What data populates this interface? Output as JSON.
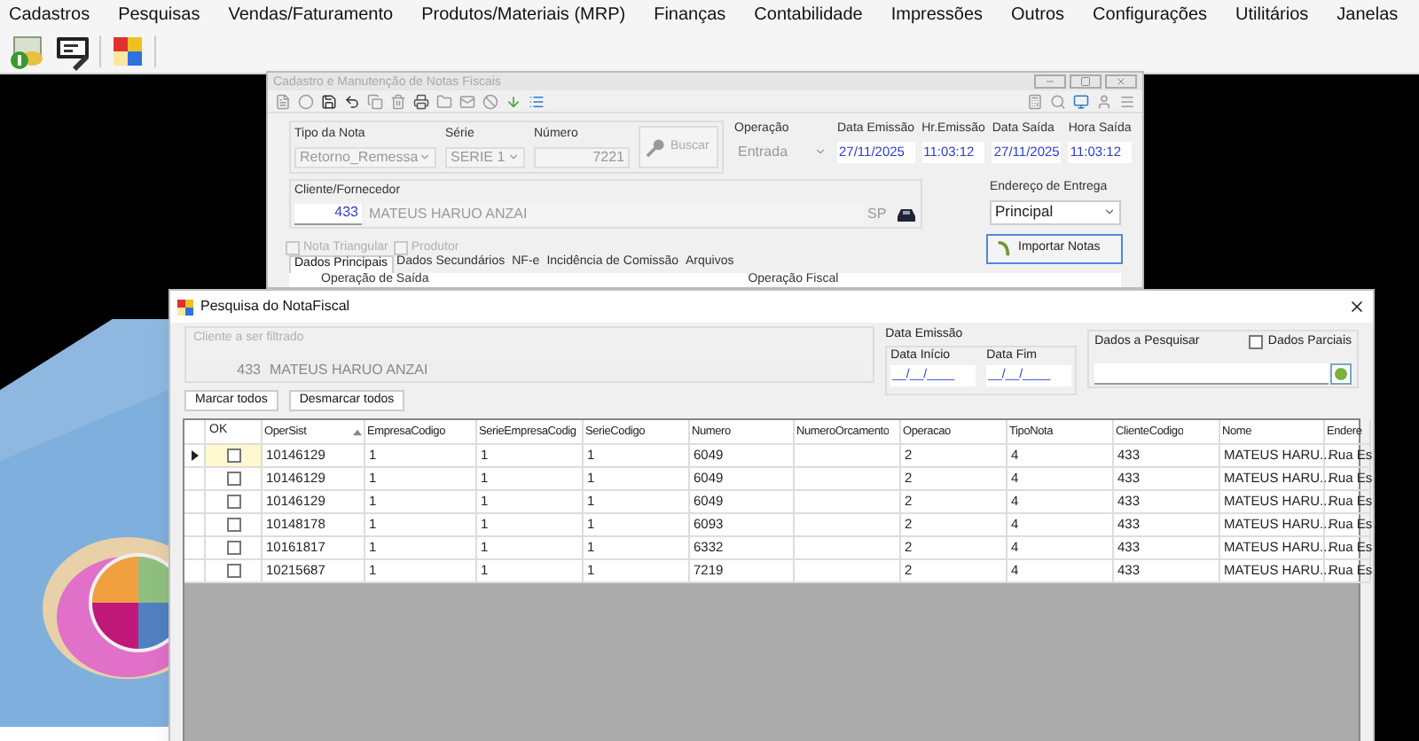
{
  "menu": [
    "Cadastros",
    "Pesquisas",
    "Vendas/Faturamento",
    "Produtos/Materiais (MRP)",
    "Finanças",
    "Contabilidade",
    "Impressões",
    "Outros",
    "Configurações",
    "Utilitários",
    "Janelas"
  ],
  "back_window": {
    "title": "Cadastro e Manutenção de Notas Fiscais",
    "tipo_nota": {
      "label": "Tipo da Nota",
      "value": "Retorno_Remessa"
    },
    "serie": {
      "label": "Série",
      "value": "SERIE 1"
    },
    "numero": {
      "label": "Número",
      "value": "7221"
    },
    "buscar_button": "Buscar",
    "operacao": {
      "label": "Operação",
      "value": "Entrada"
    },
    "dates": [
      {
        "label": "Data Emissão",
        "value": "27/11/2025"
      },
      {
        "label": "Hr.Emissão",
        "value": "11:03:12"
      },
      {
        "label": "Data Saída",
        "value": "27/11/2025"
      },
      {
        "label": "Hora Saída",
        "value": "11:03:12"
      }
    ],
    "cliente": {
      "label": "Cliente/Fornecedor",
      "code": "433",
      "name": "MATEUS HARUO ANZAI",
      "uf": "SP"
    },
    "endereco": {
      "label": "Endereço de Entrega",
      "value": "Principal"
    },
    "checkboxes": [
      {
        "label": "Nota Triangular",
        "checked": false,
        "disabled": true
      },
      {
        "label": "Produtor",
        "checked": false,
        "disabled": true
      }
    ],
    "importar_button": "Importar Notas",
    "tabs": [
      {
        "label": "Dados Principais",
        "selected": true
      },
      {
        "label": "Dados Secundários",
        "selected": false
      },
      {
        "label": "NF-e",
        "selected": false
      },
      {
        "label": "Incidência de Comissão",
        "selected": false
      },
      {
        "label": "Arquivos",
        "selected": false
      }
    ],
    "groups": [
      "Operação de Saída",
      "Operação Fiscal"
    ]
  },
  "dialog": {
    "title": "Pesquisa do NotaFiscal",
    "cliente_filter": {
      "label": "Cliente a ser filtrado",
      "code": "433",
      "name": "MATEUS HARUO ANZAI"
    },
    "data_emissao": {
      "label": "Data Emissão",
      "start": {
        "label": "Data Início",
        "value": "__/__/____"
      },
      "end": {
        "label": "Data Fim",
        "value": "__/__/____"
      }
    },
    "dados_pesquisar": {
      "label": "Dados a Pesquisar",
      "partial": {
        "label": "Dados Parciais",
        "checked": false
      }
    },
    "buttons": [
      "Marcar todos",
      "Desmarcar todos"
    ],
    "table": {
      "check_column": "OK",
      "columns": [
        {
          "label": "OperSist",
          "sorted": true
        },
        {
          "label": "EmpresaCodigo",
          "sorted": false
        },
        {
          "label": "SerieEmpresaCodig",
          "sorted": false
        },
        {
          "label": "SerieCodigo",
          "sorted": false
        },
        {
          "label": "Numero",
          "sorted": false
        },
        {
          "label": "NumeroOrcamento",
          "sorted": false
        },
        {
          "label": "Operacao",
          "sorted": false
        },
        {
          "label": "TipoNota",
          "sorted": false
        },
        {
          "label": "ClienteCodigo",
          "sorted": false
        },
        {
          "label": "Nome",
          "sorted": false
        },
        {
          "label": "Endere",
          "sorted": false
        }
      ],
      "rows": [
        {
          "selected": true,
          "checked": false,
          "cells": [
            "10146129",
            "1",
            "1",
            "1",
            "6049",
            "",
            "2",
            "4",
            "433",
            "MATEUS HARU...",
            "Rua Es"
          ]
        },
        {
          "selected": false,
          "checked": false,
          "cells": [
            "10146129",
            "1",
            "1",
            "1",
            "6049",
            "",
            "2",
            "4",
            "433",
            "MATEUS HARU...",
            "Rua Es"
          ]
        },
        {
          "selected": false,
          "checked": false,
          "cells": [
            "10146129",
            "1",
            "1",
            "1",
            "6049",
            "",
            "2",
            "4",
            "433",
            "MATEUS HARU...",
            "Rua Es"
          ]
        },
        {
          "selected": false,
          "checked": false,
          "cells": [
            "10148178",
            "1",
            "1",
            "1",
            "6093",
            "",
            "2",
            "4",
            "433",
            "MATEUS HARU...",
            "Rua Es"
          ]
        },
        {
          "selected": false,
          "checked": false,
          "cells": [
            "10161817",
            "1",
            "1",
            "1",
            "6332",
            "",
            "2",
            "4",
            "433",
            "MATEUS HARU...",
            "Rua Es"
          ]
        },
        {
          "selected": false,
          "checked": false,
          "cells": [
            "10215687",
            "1",
            "1",
            "1",
            "7219",
            "",
            "2",
            "4",
            "433",
            "MATEUS HARU...",
            "Rua Es"
          ]
        }
      ]
    }
  }
}
